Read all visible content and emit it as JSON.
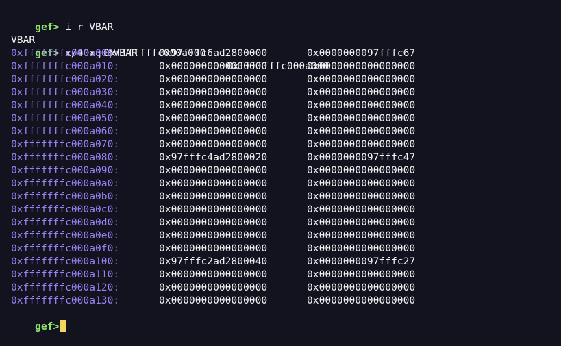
{
  "terminal": {
    "prompt": "gef>",
    "commands": [
      "i r VBAR",
      "x/40xg $VBAR"
    ],
    "register_output": {
      "name": "VBAR",
      "value_hex": "0xfffffffc000a000",
      "value_raw": "0xfffffffc000a000"
    },
    "memory_dump": [
      {
        "addr": "0xfffffffc000a000:",
        "v1": "0x97fffc6ad2800000",
        "v2": "0x0000000097fffc67"
      },
      {
        "addr": "0xfffffffc000a010:",
        "v1": "0x0000000000000000",
        "v2": "0x0000000000000000"
      },
      {
        "addr": "0xfffffffc000a020:",
        "v1": "0x0000000000000000",
        "v2": "0x0000000000000000"
      },
      {
        "addr": "0xfffffffc000a030:",
        "v1": "0x0000000000000000",
        "v2": "0x0000000000000000"
      },
      {
        "addr": "0xfffffffc000a040:",
        "v1": "0x0000000000000000",
        "v2": "0x0000000000000000"
      },
      {
        "addr": "0xfffffffc000a050:",
        "v1": "0x0000000000000000",
        "v2": "0x0000000000000000"
      },
      {
        "addr": "0xfffffffc000a060:",
        "v1": "0x0000000000000000",
        "v2": "0x0000000000000000"
      },
      {
        "addr": "0xfffffffc000a070:",
        "v1": "0x0000000000000000",
        "v2": "0x0000000000000000"
      },
      {
        "addr": "0xfffffffc000a080:",
        "v1": "0x97fffc4ad2800020",
        "v2": "0x0000000097fffc47"
      },
      {
        "addr": "0xfffffffc000a090:",
        "v1": "0x0000000000000000",
        "v2": "0x0000000000000000"
      },
      {
        "addr": "0xfffffffc000a0a0:",
        "v1": "0x0000000000000000",
        "v2": "0x0000000000000000"
      },
      {
        "addr": "0xfffffffc000a0b0:",
        "v1": "0x0000000000000000",
        "v2": "0x0000000000000000"
      },
      {
        "addr": "0xfffffffc000a0c0:",
        "v1": "0x0000000000000000",
        "v2": "0x0000000000000000"
      },
      {
        "addr": "0xfffffffc000a0d0:",
        "v1": "0x0000000000000000",
        "v2": "0x0000000000000000"
      },
      {
        "addr": "0xfffffffc000a0e0:",
        "v1": "0x0000000000000000",
        "v2": "0x0000000000000000"
      },
      {
        "addr": "0xfffffffc000a0f0:",
        "v1": "0x0000000000000000",
        "v2": "0x0000000000000000"
      },
      {
        "addr": "0xfffffffc000a100:",
        "v1": "0x97fffc2ad2800040",
        "v2": "0x0000000097fffc27"
      },
      {
        "addr": "0xfffffffc000a110:",
        "v1": "0x0000000000000000",
        "v2": "0x0000000000000000"
      },
      {
        "addr": "0xfffffffc000a120:",
        "v1": "0x0000000000000000",
        "v2": "0x0000000000000000"
      },
      {
        "addr": "0xfffffffc000a130:",
        "v1": "0x0000000000000000",
        "v2": "0x0000000000000000"
      }
    ]
  },
  "colors": {
    "background": "#12131f",
    "prompt": "#8fe36a",
    "address": "#9b82f3",
    "text": "#f2f2f2",
    "cursor": "#f2d35b"
  }
}
